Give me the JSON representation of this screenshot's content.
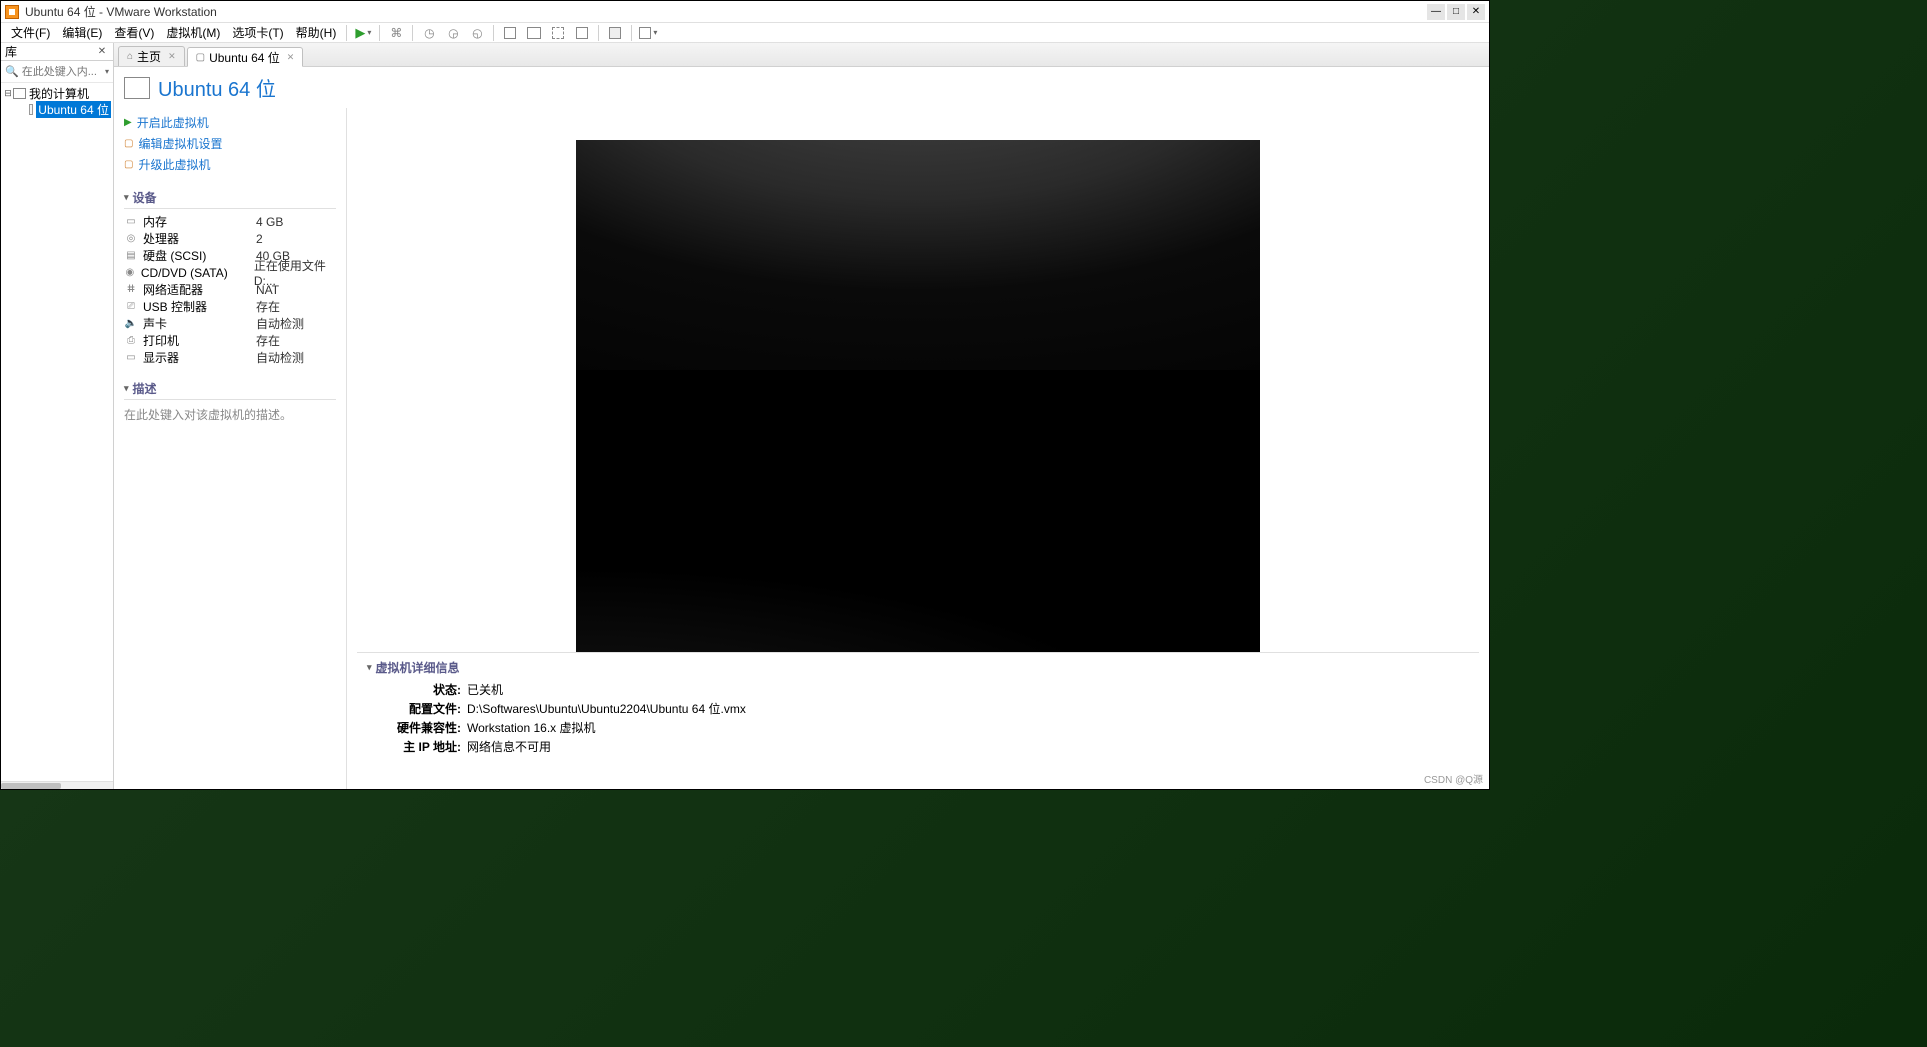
{
  "window": {
    "title": "Ubuntu 64 位 - VMware Workstation"
  },
  "menu": {
    "file": "文件(F)",
    "edit": "编辑(E)",
    "view": "查看(V)",
    "vm": "虚拟机(M)",
    "tabs": "选项卡(T)",
    "help": "帮助(H)"
  },
  "library": {
    "title": "库",
    "search_placeholder": "在此处键入内...",
    "root": "我的计算机",
    "vm_name": "Ubuntu 64 位"
  },
  "tabs": {
    "home": "主页",
    "vm": "Ubuntu 64 位"
  },
  "vm": {
    "title": "Ubuntu 64 位",
    "actions": {
      "power_on": "开启此虚拟机",
      "edit": "编辑虚拟机设置",
      "upgrade": "升级此虚拟机"
    },
    "sections": {
      "devices": "设备",
      "description": "描述",
      "details": "虚拟机详细信息"
    },
    "devices": [
      {
        "icon": "memory",
        "label": "内存",
        "value": "4 GB"
      },
      {
        "icon": "cpu",
        "label": "处理器",
        "value": "2"
      },
      {
        "icon": "disk",
        "label": "硬盘 (SCSI)",
        "value": "40 GB"
      },
      {
        "icon": "cd",
        "label": "CD/DVD (SATA)",
        "value": "正在使用文件 D:..."
      },
      {
        "icon": "net",
        "label": "网络适配器",
        "value": "NAT"
      },
      {
        "icon": "usb",
        "label": "USB 控制器",
        "value": "存在"
      },
      {
        "icon": "sound",
        "label": "声卡",
        "value": "自动检测"
      },
      {
        "icon": "printer",
        "label": "打印机",
        "value": "存在"
      },
      {
        "icon": "display",
        "label": "显示器",
        "value": "自动检测"
      }
    ],
    "description_placeholder": "在此处键入对该虚拟机的描述。",
    "details": {
      "state_k": "状态:",
      "state_v": "已关机",
      "config_k": "配置文件:",
      "config_v": "D:\\Softwares\\Ubuntu\\Ubuntu2204\\Ubuntu 64 位.vmx",
      "compat_k": "硬件兼容性:",
      "compat_v": "Workstation 16.x 虚拟机",
      "ip_k": "主 IP 地址:",
      "ip_v": "网络信息不可用"
    }
  },
  "watermark": "CSDN @Q源"
}
